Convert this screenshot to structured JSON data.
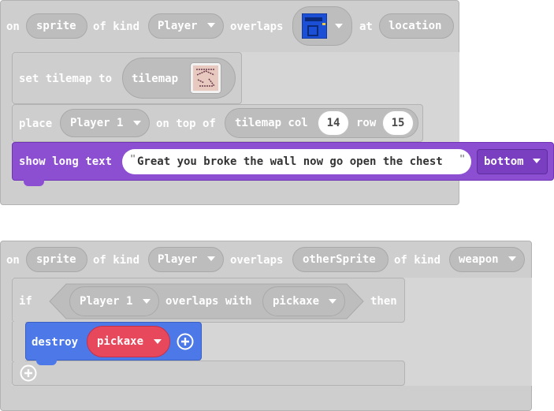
{
  "block1": {
    "on": "on",
    "sprite": "sprite",
    "of_kind": "of kind",
    "kind": "Player",
    "overlaps": "overlaps",
    "tile_icon": "tile-door-icon",
    "at": "at",
    "location": "location",
    "set_tilemap_to": "set tilemap to",
    "tilemap": "tilemap",
    "tilemap_icon": "tilemap-thumbnail-icon",
    "place": "place",
    "player1": "Player 1",
    "on_top_of": "on top of",
    "tilemap_col": "tilemap col",
    "col": "14",
    "row_label": "row",
    "row": "15",
    "show_long_text": "show long text",
    "quote_open": "\"",
    "message": "Great you broke the wall now go open the chest",
    "quote_close": "\"",
    "position": "bottom"
  },
  "block2": {
    "on": "on",
    "sprite": "sprite",
    "of_kind": "of kind",
    "kind": "Player",
    "overlaps": "overlaps",
    "other_sprite": "otherSprite",
    "of_kind2": "of kind",
    "kind2": "weapon",
    "if": "if",
    "player1": "Player 1",
    "overlaps_with": "overlaps with",
    "target": "pickaxe",
    "then": "then",
    "destroy": "destroy",
    "destroy_target": "pickaxe"
  },
  "colors": {
    "event_gray": "#cecece",
    "purple": "#8d4fd2",
    "blue": "#4c78e8",
    "red": "#e8485c"
  }
}
